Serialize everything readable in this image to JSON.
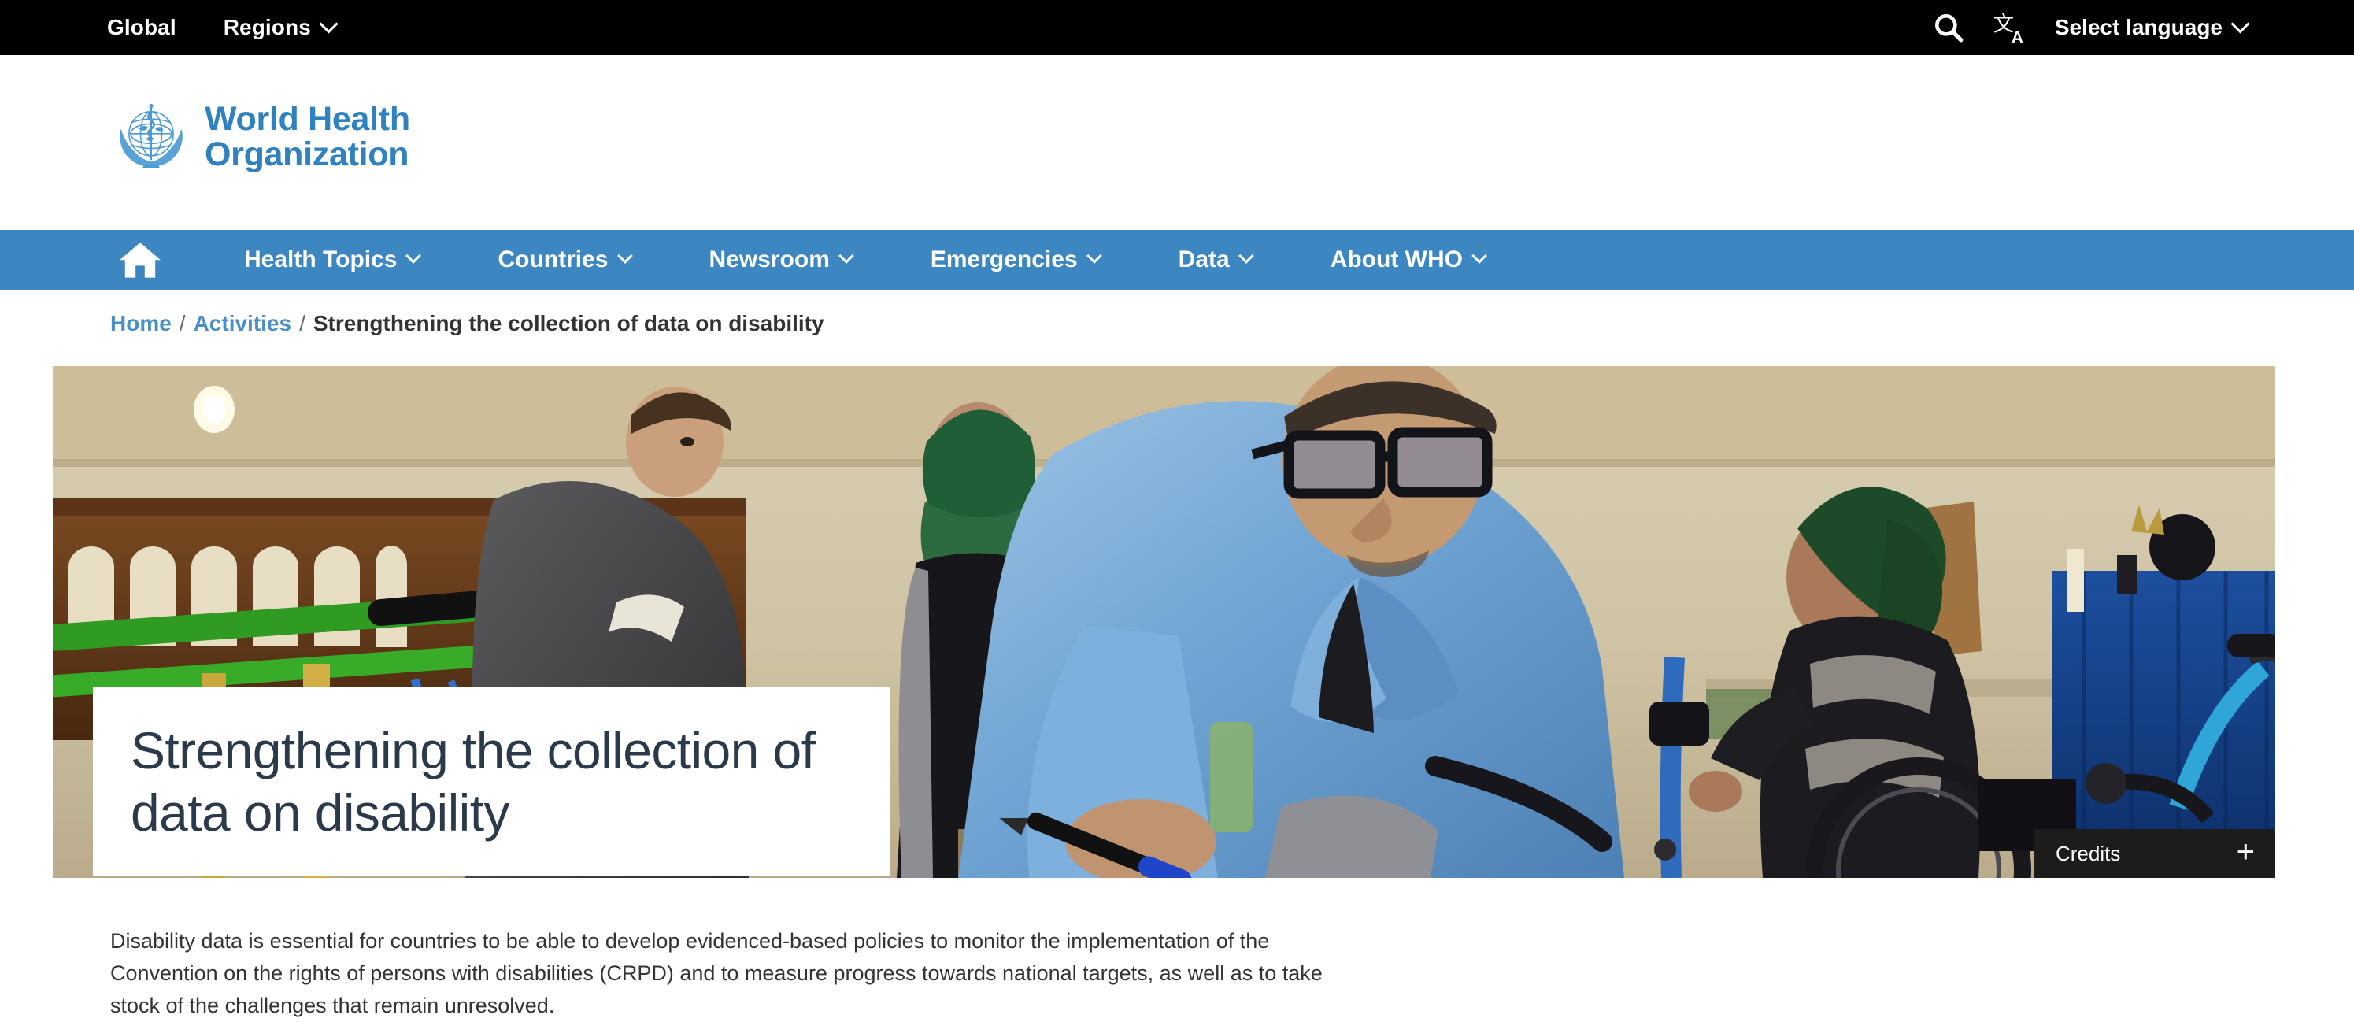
{
  "topbar": {
    "global_label": "Global",
    "regions_label": "Regions",
    "search_icon": "search-icon",
    "translate_icon": "translate-icon",
    "language_label": "Select language",
    "chevron_icon": "chevron-down-icon"
  },
  "header": {
    "logo_line1": "World Health",
    "logo_line2": "Organization",
    "logo_icon": "who-emblem-icon",
    "logo_color": "#2f81c0"
  },
  "mainnav": {
    "background_color": "#3c86c2",
    "home_icon": "home-icon",
    "items": [
      {
        "label": "Health Topics",
        "has_dropdown": true
      },
      {
        "label": "Countries",
        "has_dropdown": true
      },
      {
        "label": "Newsroom",
        "has_dropdown": true
      },
      {
        "label": "Emergencies",
        "has_dropdown": true
      },
      {
        "label": "Data",
        "has_dropdown": true
      },
      {
        "label": "About WHO",
        "has_dropdown": true
      }
    ]
  },
  "breadcrumb": {
    "home": "Home",
    "sep1": "/",
    "activities": "Activities",
    "sep2": "/",
    "current": "Strengthening the collection of data on disability",
    "link_color": "#4a8fc8"
  },
  "hero": {
    "title": "Strengthening the collection of data on disability",
    "credits_label": "Credits",
    "credits_expand_icon": "plus-icon",
    "photo_description": "Rehabilitation centre: a health worker in a light blue coat holds a blue pen while assessing a patient; a young man stands at green parallel bars, and a woman in a green headscarf sits in a wheelchair beside a blue curtain."
  },
  "main": {
    "lede": "Disability data is essential for countries to be able to develop evidenced-based policies to monitor the implementation of the Convention on the rights of persons with disabilities (CRPD) and to measure progress towards national targets, as well as to take stock of the challenges that remain unresolved."
  }
}
